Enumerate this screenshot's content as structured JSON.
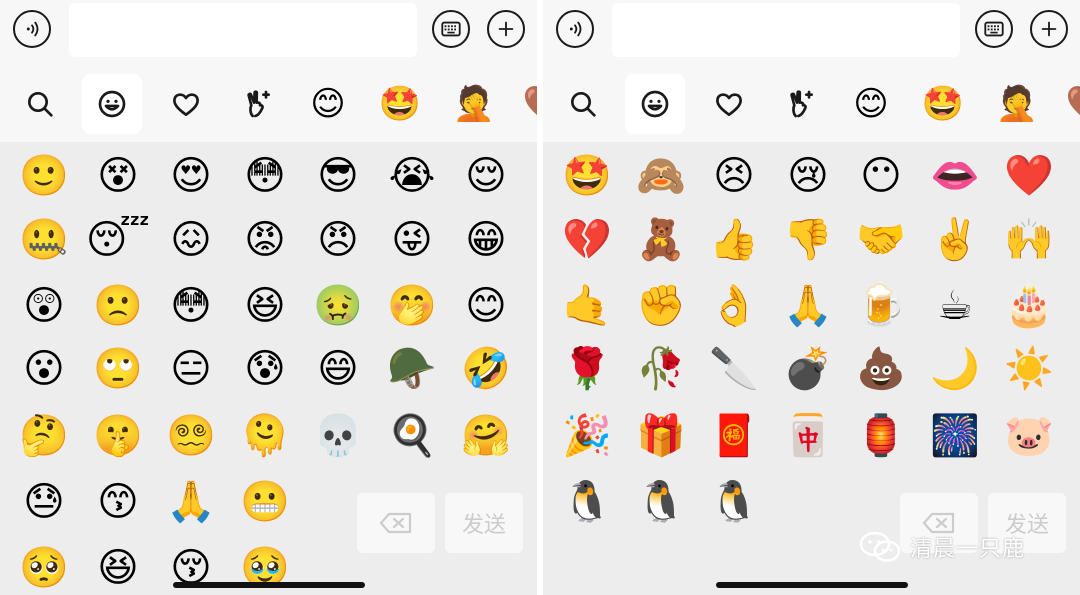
{
  "screens": [
    {
      "input": {
        "value": ""
      },
      "tabs": [
        {
          "icon": "search-icon"
        },
        {
          "icon": "smiley-icon"
        },
        {
          "icon": "heart-icon"
        },
        {
          "icon": "hand-gesture-icon"
        },
        {
          "icon": "smile-sticker-icon",
          "glyph": "😊"
        },
        {
          "icon": "star-eyes-sticker-icon",
          "glyph": "🤩"
        },
        {
          "icon": "facepalm-sticker-icon",
          "glyph": "🤦"
        },
        {
          "icon": "partial-sticker-icon",
          "glyph": "🤎"
        }
      ],
      "emojis": [
        [
          "🙂",
          "😵",
          "😍",
          "😳",
          "😎",
          "😭",
          "😌"
        ],
        [
          "🤐",
          "😴",
          "😖",
          "😡",
          "😠",
          "😜",
          "😁"
        ],
        [
          "😲",
          "🙁",
          "😳",
          "😆",
          "🤢",
          "🤭",
          "😊"
        ],
        [
          "😮",
          "🙄",
          "😑",
          "😰",
          "😄",
          "🪖",
          "🤣"
        ],
        [
          "🤔",
          "🤫",
          "😵‍💫",
          "🫠",
          "💀",
          "🍳",
          "🤗"
        ],
        [
          "😓",
          "😙",
          "🙏",
          "😬"
        ],
        [
          "🥺",
          "😆",
          "😚",
          "🥹"
        ]
      ],
      "send_label": "发送"
    },
    {
      "input": {
        "value": ""
      },
      "tabs": [
        {
          "icon": "search-icon"
        },
        {
          "icon": "smiley-icon"
        },
        {
          "icon": "heart-icon"
        },
        {
          "icon": "hand-gesture-icon"
        },
        {
          "icon": "smile-sticker-icon",
          "glyph": "😊"
        },
        {
          "icon": "star-eyes-sticker-icon",
          "glyph": "🤩"
        },
        {
          "icon": "facepalm-sticker-icon",
          "glyph": "🤦"
        },
        {
          "icon": "partial-sticker-icon",
          "glyph": "🤎"
        }
      ],
      "emojis": [
        [
          "🤩",
          "🙈",
          "😣",
          "😢",
          "😶",
          "👄",
          "❤️"
        ],
        [
          "💔",
          "🧸",
          "👍",
          "👎",
          "🤝",
          "✌️",
          "🙌"
        ],
        [
          "🤙",
          "✊",
          "👌",
          "🙏",
          "🍺",
          "☕",
          "🎂"
        ],
        [
          "🌹",
          "🥀",
          "🔪",
          "💣",
          "💩",
          "🌙",
          "☀️"
        ],
        [
          "🎉",
          "🎁",
          "🧧",
          "🀄",
          "🏮",
          "🎆",
          "🐷"
        ],
        [
          "🐧",
          "🐧",
          "🐧"
        ]
      ],
      "send_label": "发送"
    }
  ],
  "watermark": {
    "text": "清晨一只鹿"
  }
}
